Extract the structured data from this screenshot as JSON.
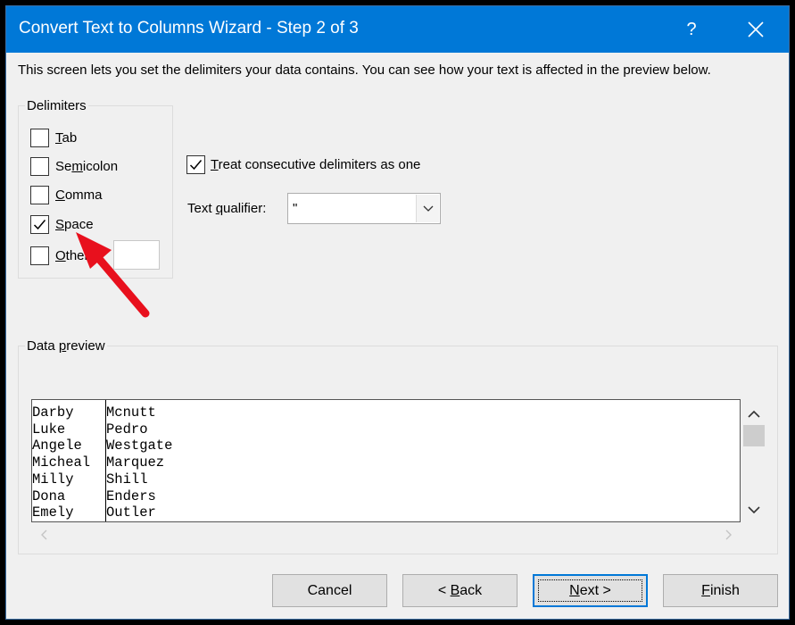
{
  "window": {
    "title": "Convert Text to Columns Wizard - Step 2 of 3",
    "help_label": "?",
    "close_label": "✕"
  },
  "description": "This screen lets you set the delimiters your data contains.  You can see how your text is affected in the preview below.",
  "delimiters": {
    "legend": "Delimiters",
    "tab": {
      "pre": "",
      "key": "T",
      "post": "ab",
      "checked": false
    },
    "semicolon": {
      "pre": "Se",
      "key": "m",
      "post": "icolon",
      "checked": false
    },
    "comma": {
      "pre": "",
      "key": "C",
      "post": "omma",
      "checked": false
    },
    "space": {
      "pre": "",
      "key": "S",
      "post": "pace",
      "checked": true
    },
    "other": {
      "pre": "",
      "key": "O",
      "post": "ther:",
      "checked": false,
      "value": ""
    }
  },
  "consecutive": {
    "pre": "",
    "key": "T",
    "post": "reat consecutive delimiters as one",
    "checked": true
  },
  "text_qualifier": {
    "label_pre": "Text ",
    "label_key": "q",
    "label_post": "ualifier:",
    "value": "\""
  },
  "preview": {
    "legend_pre": "Data ",
    "legend_key": "p",
    "legend_post": "review",
    "col1": [
      "Darby",
      "Luke",
      "Angele",
      "Micheal",
      "Milly",
      "Dona",
      "Emely"
    ],
    "col2": [
      "Mcnutt",
      "Pedro",
      "Westgate",
      "Marquez",
      "Shill",
      "Enders",
      "Outler"
    ]
  },
  "buttons": {
    "cancel": "Cancel",
    "back_pre": "< ",
    "back_key": "B",
    "back_post": "ack",
    "next_pre": "",
    "next_key": "N",
    "next_post": "ext >",
    "finish_pre": "",
    "finish_key": "F",
    "finish_post": "inish"
  },
  "colors": {
    "titlebar": "#0078d7",
    "dialog_bg": "#f0f0f0",
    "annotation_arrow": "#e8101d"
  }
}
